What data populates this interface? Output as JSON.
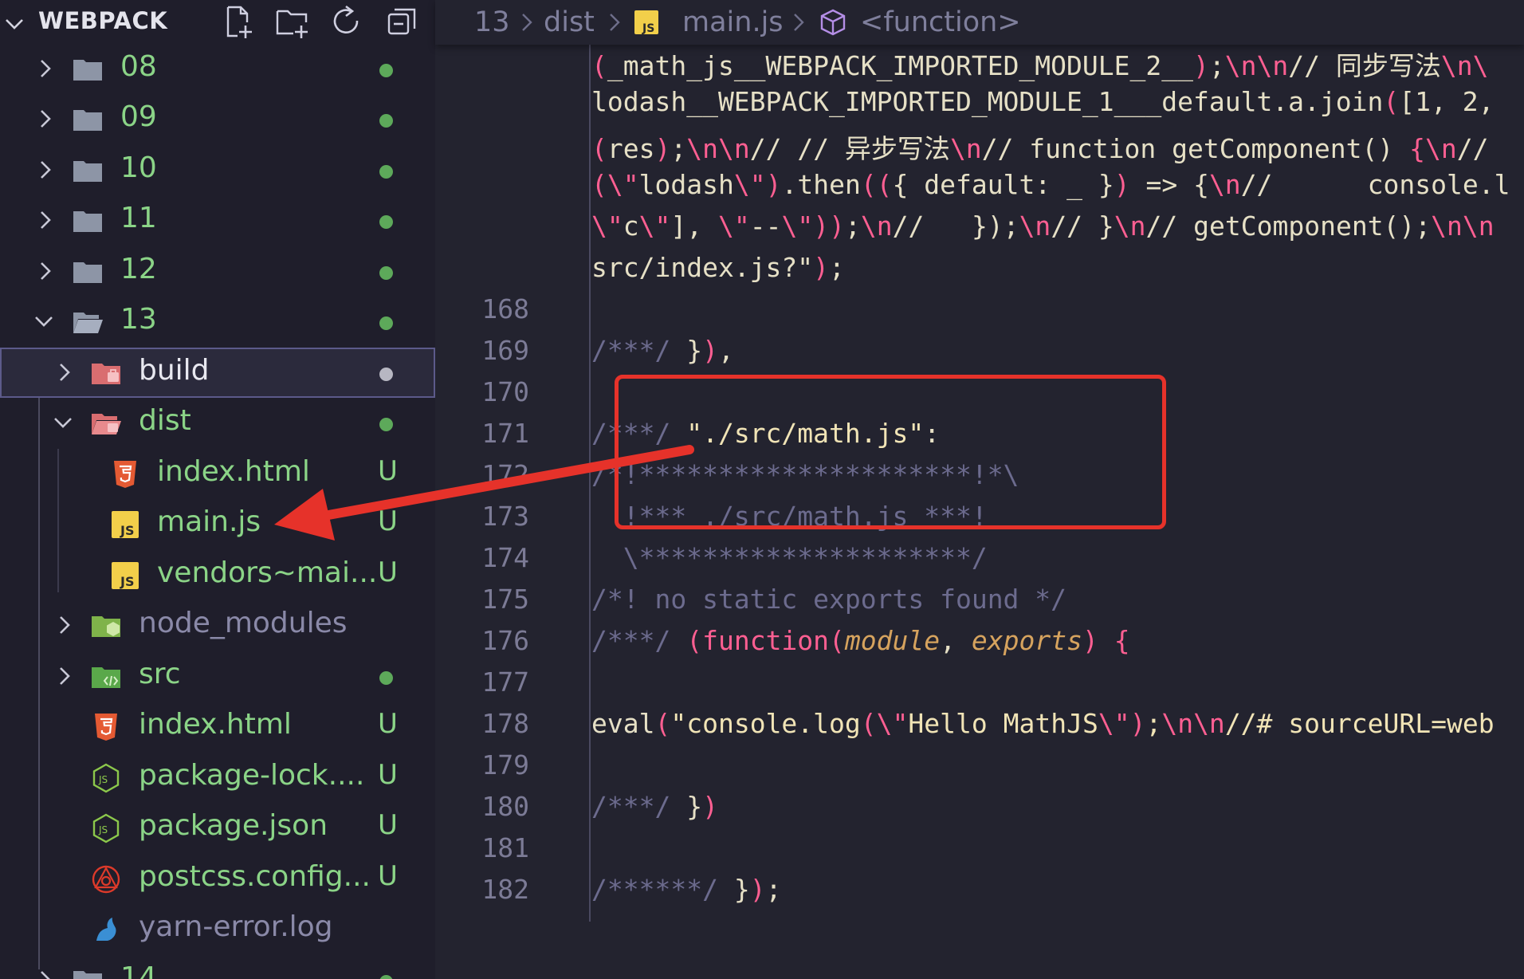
{
  "explorer": {
    "title": "WEBPACK",
    "header_icons": [
      "new-file-icon",
      "new-folder-icon",
      "refresh-icon",
      "collapse-all-icon"
    ],
    "items": [
      {
        "label": "08",
        "type": "folder",
        "expanded": false,
        "status": "dot"
      },
      {
        "label": "09",
        "type": "folder",
        "expanded": false,
        "status": "dot"
      },
      {
        "label": "10",
        "type": "folder",
        "expanded": false,
        "status": "dot"
      },
      {
        "label": "11",
        "type": "folder",
        "expanded": false,
        "status": "dot"
      },
      {
        "label": "12",
        "type": "folder",
        "expanded": false,
        "status": "dot"
      },
      {
        "label": "13",
        "type": "folder",
        "expanded": true,
        "status": "dot"
      },
      {
        "label": "build",
        "type": "build-folder",
        "expanded": false,
        "status": "dot-gray",
        "selected": true
      },
      {
        "label": "dist",
        "type": "dist-folder",
        "expanded": true,
        "status": "dot"
      },
      {
        "label": "index.html",
        "type": "html",
        "status": "U"
      },
      {
        "label": "main.js",
        "type": "js",
        "status": "U"
      },
      {
        "label": "vendors~mai...",
        "type": "js",
        "status": "U"
      },
      {
        "label": "node_modules",
        "type": "node-folder",
        "expanded": false,
        "status": ""
      },
      {
        "label": "src",
        "type": "src-folder",
        "expanded": false,
        "status": "dot"
      },
      {
        "label": "index.html",
        "type": "html",
        "status": "U"
      },
      {
        "label": "package-lock....",
        "type": "node-json",
        "status": "U"
      },
      {
        "label": "package.json",
        "type": "node-json",
        "status": "U"
      },
      {
        "label": "postcss.config...",
        "type": "postcss",
        "status": "U"
      },
      {
        "label": "yarn-error.log",
        "type": "yarn",
        "status": ""
      },
      {
        "label": "14",
        "type": "folder",
        "expanded": false,
        "status": "dot"
      }
    ]
  },
  "breadcrumb": {
    "seg1": "13",
    "seg2": "dist",
    "seg3": "main.js",
    "seg3_icon_text": "JS",
    "seg4": "<function>"
  },
  "editor": {
    "lines": [
      {
        "n": "",
        "tokens": [
          [
            "br",
            "("
          ],
          [
            "fn",
            "_math_js__WEBPACK_IMPORTED_MODULE_2__"
          ],
          [
            "br",
            ")"
          ],
          [
            "fn",
            ";"
          ],
          [
            "esc",
            "\\n\\n"
          ],
          [
            "fn",
            "// 同步写法"
          ],
          [
            "esc",
            "\\n\\"
          ]
        ]
      },
      {
        "n": "",
        "tokens": [
          [
            "fn",
            "lodash__WEBPACK_IMPORTED_MODULE_1___default.a.join"
          ],
          [
            "br",
            "("
          ],
          [
            "fn",
            "[1, 2,"
          ]
        ]
      },
      {
        "n": "",
        "tokens": [
          [
            "br",
            "("
          ],
          [
            "fn",
            "res"
          ],
          [
            "br",
            ")"
          ],
          [
            "fn",
            ";"
          ],
          [
            "esc",
            "\\n\\n"
          ],
          [
            "fn",
            "// // 异步写法"
          ],
          [
            "esc",
            "\\n"
          ],
          [
            "fn",
            "// function getComponent() "
          ],
          [
            "br",
            "{"
          ],
          [
            "esc",
            "\\n"
          ],
          [
            "fn",
            "//"
          ]
        ]
      },
      {
        "n": "",
        "tokens": [
          [
            "br",
            "("
          ],
          [
            "esc",
            "\\\""
          ],
          [
            "fn",
            "lodash"
          ],
          [
            "esc",
            "\\\""
          ],
          [
            "br",
            ")"
          ],
          [
            "fn",
            ".then"
          ],
          [
            "br",
            "(("
          ],
          [
            "fn",
            "{ default: _ }"
          ],
          [
            "br",
            ")"
          ],
          [
            "fn",
            " => {"
          ],
          [
            "esc",
            "\\n"
          ],
          [
            "fn",
            "//      console.l"
          ]
        ]
      },
      {
        "n": "",
        "tokens": [
          [
            "esc",
            "\\\""
          ],
          [
            "fn",
            "c"
          ],
          [
            "esc",
            "\\\""
          ],
          [
            "fn",
            "], "
          ],
          [
            "esc",
            "\\\""
          ],
          [
            "fn",
            "--"
          ],
          [
            "esc",
            "\\\""
          ],
          [
            "br",
            "))"
          ],
          [
            "fn",
            ";"
          ],
          [
            "esc",
            "\\n"
          ],
          [
            "fn",
            "//   });"
          ],
          [
            "esc",
            "\\n"
          ],
          [
            "fn",
            "// }"
          ],
          [
            "esc",
            "\\n"
          ],
          [
            "fn",
            "// getComponent();"
          ],
          [
            "esc",
            "\\n\\n"
          ]
        ]
      },
      {
        "n": "",
        "tokens": [
          [
            "fn",
            "src/index.js?\""
          ],
          [
            "br",
            ")"
          ],
          [
            "fn",
            ";"
          ]
        ]
      },
      {
        "n": "168",
        "tokens": []
      },
      {
        "n": "169",
        "tokens": [
          [
            "cm",
            "/***/ "
          ],
          [
            "fn",
            "}"
          ],
          [
            "br",
            ")"
          ],
          [
            "fn",
            ","
          ]
        ]
      },
      {
        "n": "170",
        "tokens": []
      },
      {
        "n": "171",
        "tokens": [
          [
            "cm",
            "/***/ "
          ],
          [
            "str",
            "\"./src/math.js\""
          ],
          [
            "fn",
            ":"
          ]
        ]
      },
      {
        "n": "172",
        "tokens": [
          [
            "cm",
            "/*!*********************!*\\"
          ]
        ]
      },
      {
        "n": "173",
        "tokens": [
          [
            "cm",
            "  !*** ./src/math.js ***!"
          ]
        ]
      },
      {
        "n": "174",
        "tokens": [
          [
            "cm",
            "  \\*********************/"
          ]
        ]
      },
      {
        "n": "175",
        "tokens": [
          [
            "cm",
            "/*! no static exports found */"
          ]
        ]
      },
      {
        "n": "176",
        "tokens": [
          [
            "cm",
            "/***/ "
          ],
          [
            "br",
            "("
          ],
          [
            "kw",
            "function"
          ],
          [
            "br",
            "("
          ],
          [
            "param",
            "module"
          ],
          [
            "fn",
            ", "
          ],
          [
            "param",
            "exports"
          ],
          [
            "br",
            ")"
          ],
          [
            "fn",
            " "
          ],
          [
            "br",
            "{"
          ]
        ]
      },
      {
        "n": "177",
        "tokens": []
      },
      {
        "n": "178",
        "tokens": [
          [
            "fn",
            "eval"
          ],
          [
            "br",
            "("
          ],
          [
            "str",
            "\"console.log"
          ],
          [
            "br",
            "("
          ],
          [
            "esc",
            "\\\""
          ],
          [
            "str",
            "Hello MathJS"
          ],
          [
            "esc",
            "\\\""
          ],
          [
            "br",
            ")"
          ],
          [
            "str",
            ";"
          ],
          [
            "esc",
            "\\n\\n"
          ],
          [
            "str",
            "//# sourceURL=web"
          ]
        ]
      },
      {
        "n": "179",
        "tokens": []
      },
      {
        "n": "180",
        "tokens": [
          [
            "cm",
            "/***/ "
          ],
          [
            "fn",
            "}"
          ],
          [
            "br",
            ")"
          ]
        ]
      },
      {
        "n": "181",
        "tokens": []
      },
      {
        "n": "182",
        "tokens": [
          [
            "cm",
            "/******/ "
          ],
          [
            "fn",
            "}"
          ],
          [
            "br",
            ")"
          ],
          [
            "fn",
            ";"
          ]
        ]
      }
    ]
  },
  "colors": {
    "sidebar_bg": "#1f1e2b",
    "editor_bg": "#23232f",
    "untracked_green": "#8bd487",
    "annotation_red": "#e6322a"
  }
}
